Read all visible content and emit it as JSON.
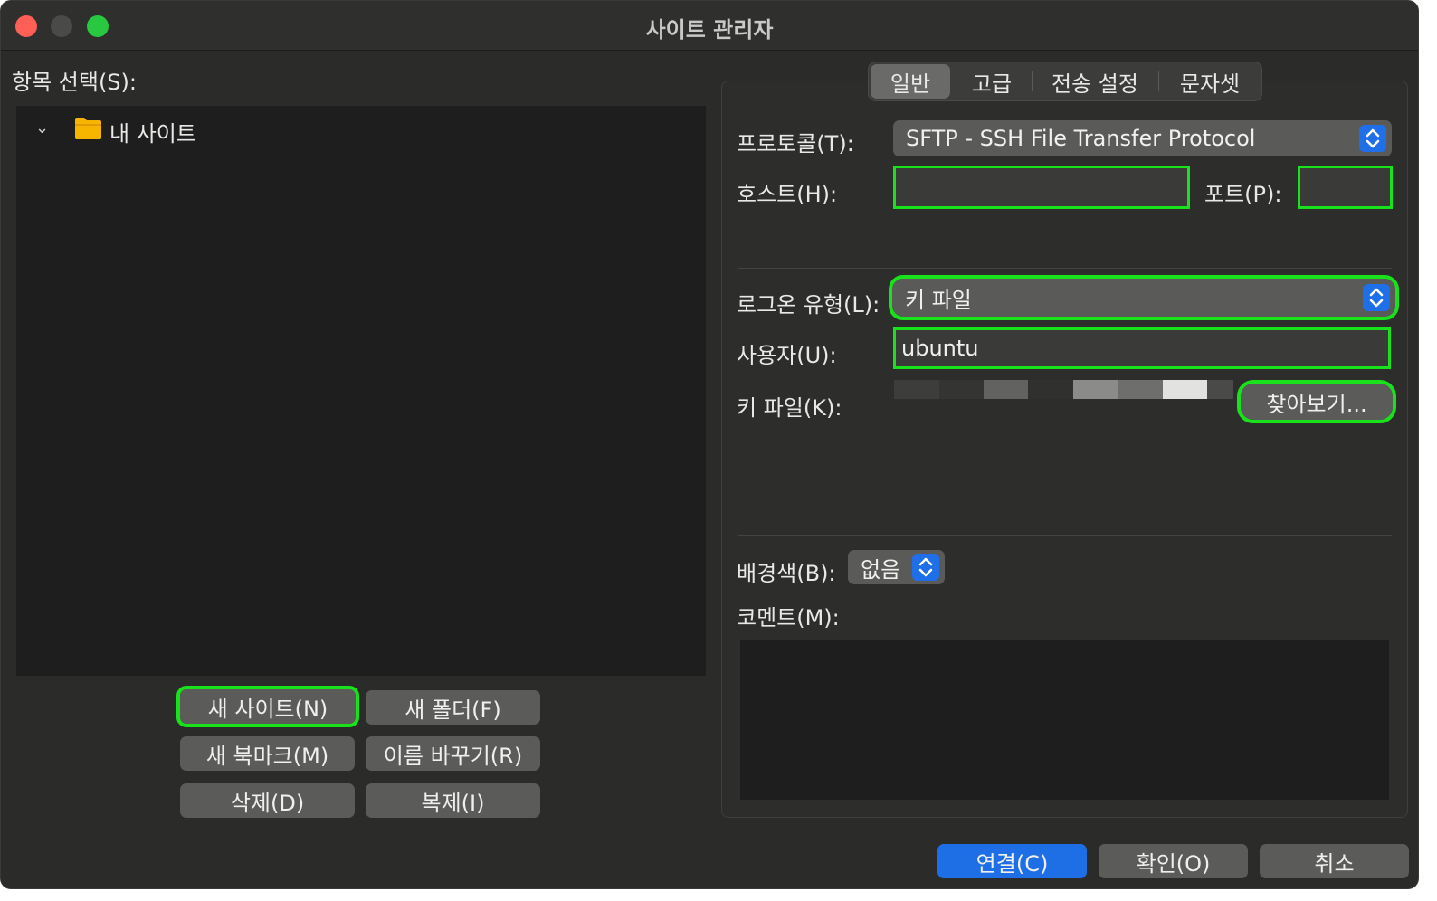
{
  "window": {
    "title": "사이트 관리자"
  },
  "left": {
    "select_label": "항목 선택(S):",
    "tree": {
      "root_label": "내 사이트"
    },
    "buttons": {
      "new_site": "새 사이트(N)",
      "new_folder": "새 폴더(F)",
      "new_bookmark": "새 북마크(M)",
      "rename": "이름 바꾸기(R)",
      "delete": "삭제(D)",
      "duplicate": "복제(I)"
    }
  },
  "tabs": [
    "일반",
    "고급",
    "전송 설정",
    "문자셋"
  ],
  "general": {
    "protocol_label": "프로토콜(T):",
    "protocol_value": "SFTP - SSH File Transfer Protocol",
    "host_label": "호스트(H):",
    "host_value": "",
    "port_label": "포트(P):",
    "port_value": "",
    "logon_label": "로그온 유형(L):",
    "logon_value": "키 파일",
    "user_label": "사용자(U):",
    "user_value": "ubuntu",
    "keyfile_label": "키 파일(K):",
    "browse_button": "찾아보기...",
    "bgcolor_label": "배경색(B):",
    "bgcolor_value": "없음",
    "comment_label": "코멘트(M):"
  },
  "footer": {
    "connect": "연결(C)",
    "ok": "확인(O)",
    "cancel": "취소"
  },
  "colors": {
    "accent": "#1e6fe6",
    "highlight": "#19e11b",
    "folder": "#f7b500"
  }
}
